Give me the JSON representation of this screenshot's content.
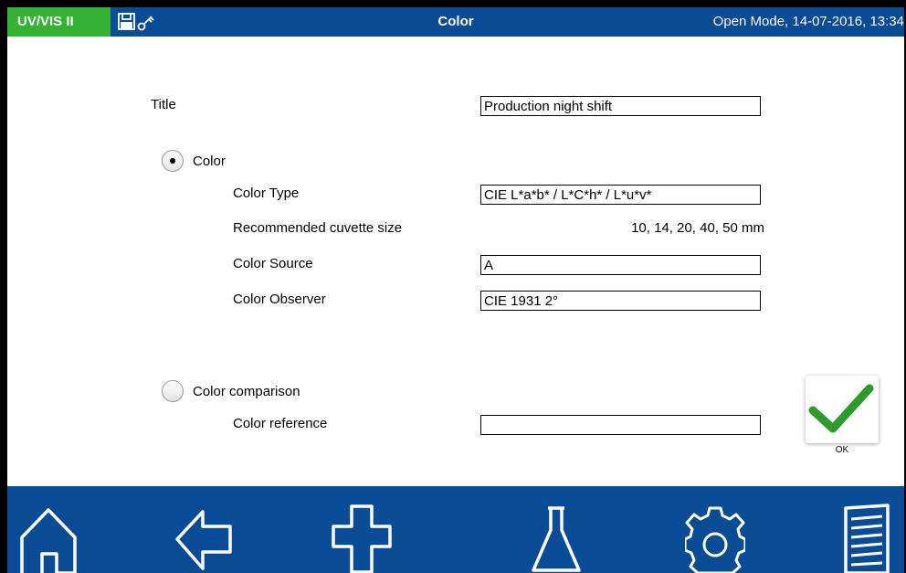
{
  "header": {
    "app_name": "UV/VIS II",
    "screen_title": "Color",
    "mode_text": "Open Mode, 14-07-2016, 13:34",
    "icons": [
      "save-icon",
      "key-icon"
    ]
  },
  "form": {
    "title_label": "Title",
    "title_value": "Production night shift",
    "color_option": {
      "label": "Color",
      "selected": true,
      "color_type_label": "Color Type",
      "color_type_value": "CIE L*a*b* / L*C*h* / L*u*v*",
      "cuvette_label": "Recommended cuvette size",
      "cuvette_value": "10, 14, 20, 40, 50 mm",
      "source_label": "Color Source",
      "source_value": "A",
      "observer_label": "Color Observer",
      "observer_value": "CIE 1931 2°"
    },
    "comparison_option": {
      "label": "Color comparison",
      "selected": false,
      "reference_label": "Color reference",
      "reference_value": ""
    }
  },
  "ok_button": {
    "label": "OK",
    "icon": "check-icon"
  },
  "nav": [
    "home-icon",
    "back-arrow-icon",
    "plus-icon",
    "flask-icon",
    "gear-icon",
    "menu-list-icon"
  ],
  "colors": {
    "header_blue": "#0a4b95",
    "badge_green": "#35b236",
    "check_green": "#2e9a2e"
  }
}
